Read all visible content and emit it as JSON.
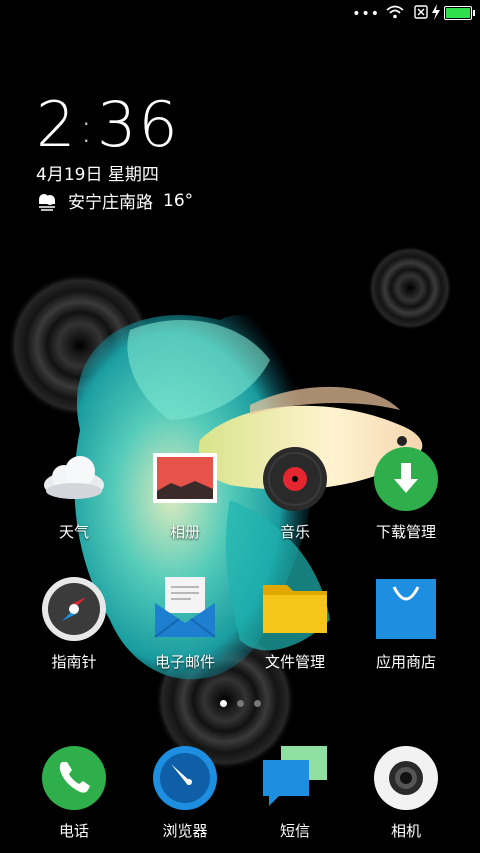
{
  "status": {
    "dots": "•••"
  },
  "clock": {
    "hour": "2",
    "minute": "36"
  },
  "date": "4月19日 星期四",
  "weather": {
    "location": "安宁庄南路",
    "temperature": "16°"
  },
  "apps": [
    {
      "label": "天气",
      "icon": "weather-icon"
    },
    {
      "label": "相册",
      "icon": "gallery-icon"
    },
    {
      "label": "音乐",
      "icon": "music-icon"
    },
    {
      "label": "下载管理",
      "icon": "download-icon"
    },
    {
      "label": "指南针",
      "icon": "compass-icon"
    },
    {
      "label": "电子邮件",
      "icon": "email-icon"
    },
    {
      "label": "文件管理",
      "icon": "folder-icon"
    },
    {
      "label": "应用商店",
      "icon": "app-store-icon"
    }
  ],
  "dock": [
    {
      "label": "电话",
      "icon": "phone-icon"
    },
    {
      "label": "浏览器",
      "icon": "browser-icon"
    },
    {
      "label": "短信",
      "icon": "messages-icon"
    },
    {
      "label": "相机",
      "icon": "camera-icon"
    }
  ],
  "pager": {
    "pages": 3,
    "active": 0
  },
  "colors": {
    "battery": "#2ee04b",
    "download": "#2faf4b",
    "phone": "#2faf4b",
    "browser": "#1e8ee0",
    "folder": "#f6b800",
    "store": "#1e8ee0"
  }
}
